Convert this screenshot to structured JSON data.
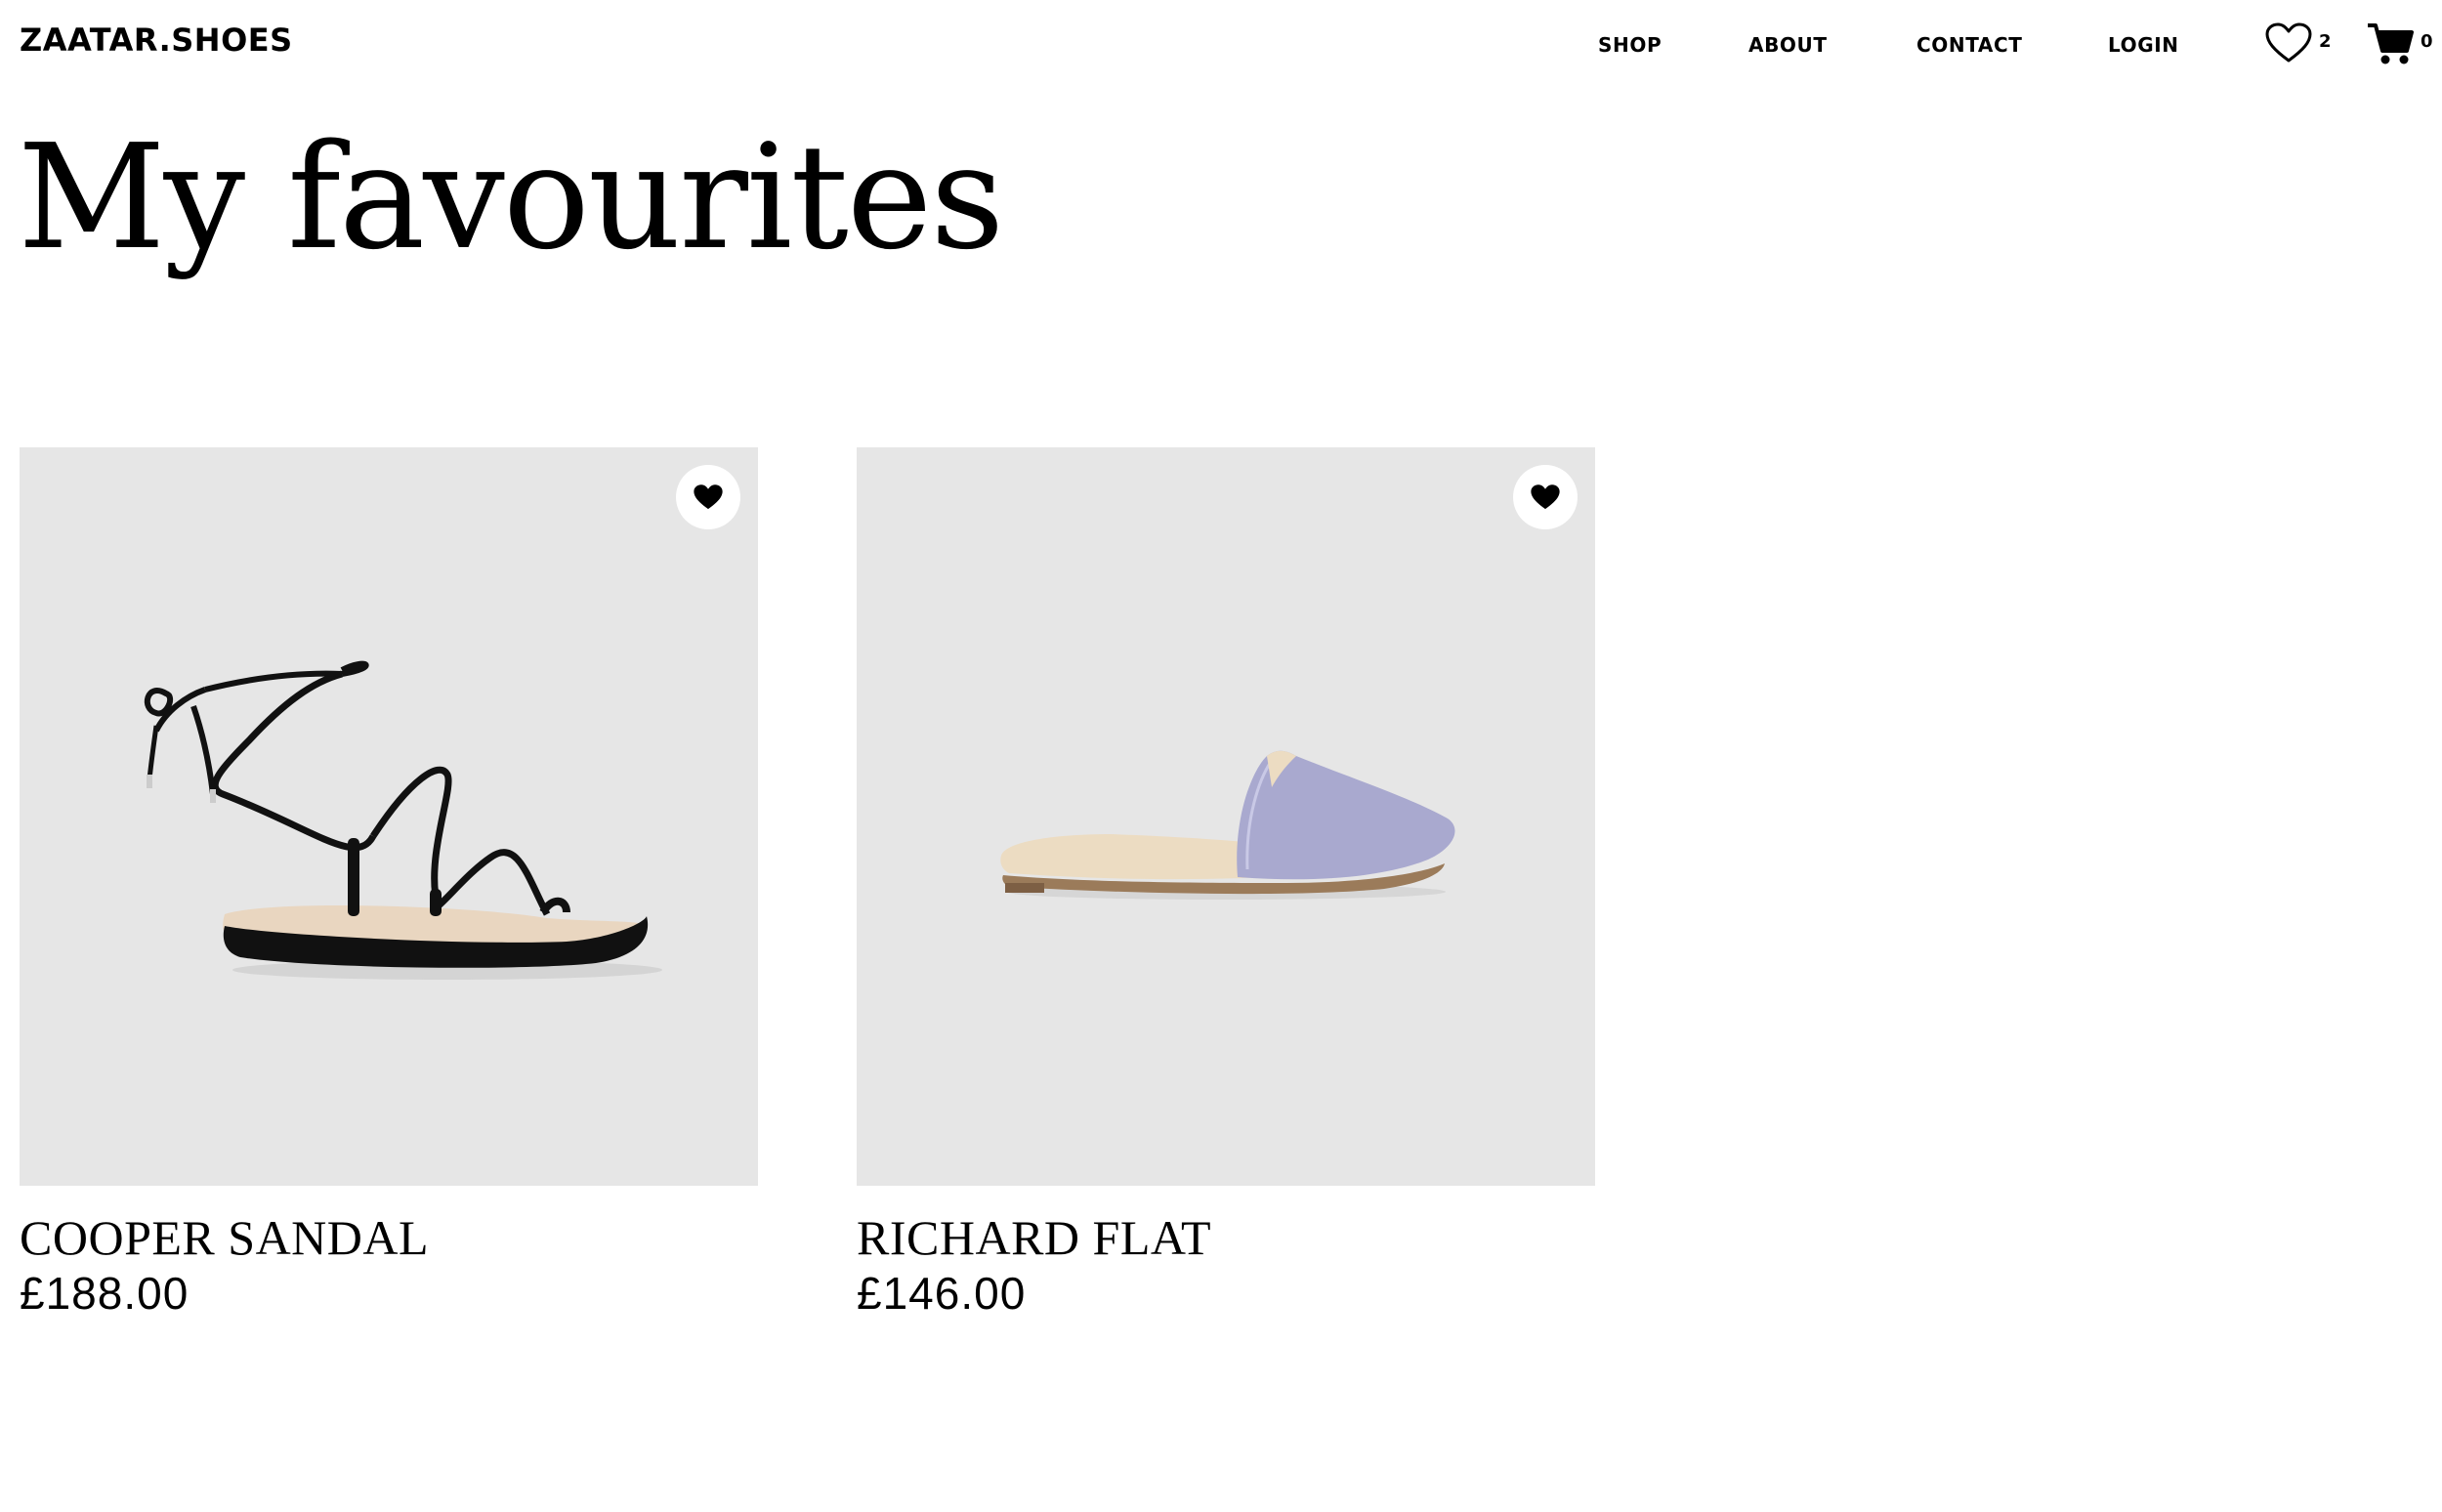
{
  "header": {
    "logo": "ZAATAR.SHOES",
    "nav": [
      {
        "label": "SHOP"
      },
      {
        "label": "ABOUT"
      },
      {
        "label": "CONTACT"
      },
      {
        "label": "LOGIN"
      }
    ],
    "favourites": {
      "icon": "heart-outline-icon",
      "count": "2"
    },
    "cart": {
      "icon": "cart-icon",
      "count": "0"
    }
  },
  "page": {
    "title": "My favourites"
  },
  "products": [
    {
      "name": "COOPER SANDAL",
      "price": "£188.00",
      "image": "black strappy lace-up toe-ring sandal",
      "favourited": true,
      "image_background": "#e6e6e6",
      "shoe_color": "#111111"
    },
    {
      "name": "RICHARD FLAT",
      "price": "£146.00",
      "image": "lilac pointed-toe mule flat",
      "favourited": true,
      "image_background": "#e6e6e6",
      "shoe_color": "#a9a9cf"
    }
  ],
  "colors": {
    "text": "#000000",
    "background": "#ffffff",
    "card": "#e6e6e6"
  }
}
